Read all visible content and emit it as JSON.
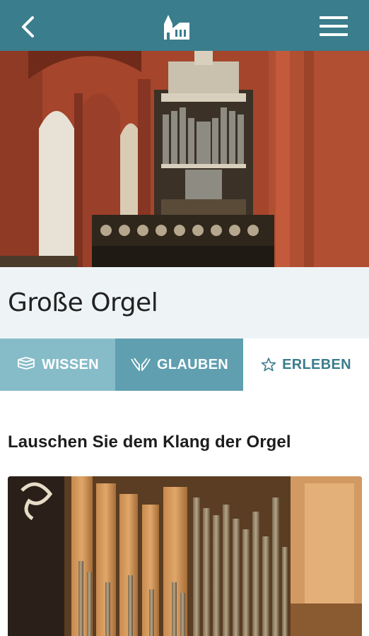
{
  "header": {
    "back_icon": "back-chevron-icon",
    "logo_icon": "church-logo-icon",
    "menu_icon": "hamburger-menu-icon",
    "color": "#3a7d8c"
  },
  "hero": {
    "image": "organ-photo"
  },
  "title": "Große Orgel",
  "tabs": [
    {
      "label": "WISSEN",
      "icon": "book-stack-icon",
      "color": "#86bcc8"
    },
    {
      "label": "GLAUBEN",
      "icon": "praying-hands-icon",
      "color": "#5f9faf"
    },
    {
      "label": "ERLEBEN",
      "icon": "star-icon",
      "color": "#ffffff"
    }
  ],
  "content": {
    "heading": "Lauschen Sie dem Klang der Orgel",
    "image": "organ-pipes-photo"
  }
}
